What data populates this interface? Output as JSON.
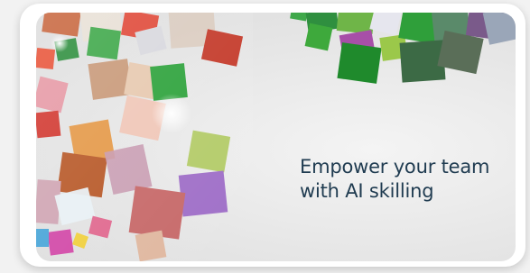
{
  "banner": {
    "headline_line1": "Empower your team",
    "headline_line2": "with AI skilling",
    "headline_color": "#1f3b50",
    "artwork": "abstract-colored-glass-cubes"
  }
}
